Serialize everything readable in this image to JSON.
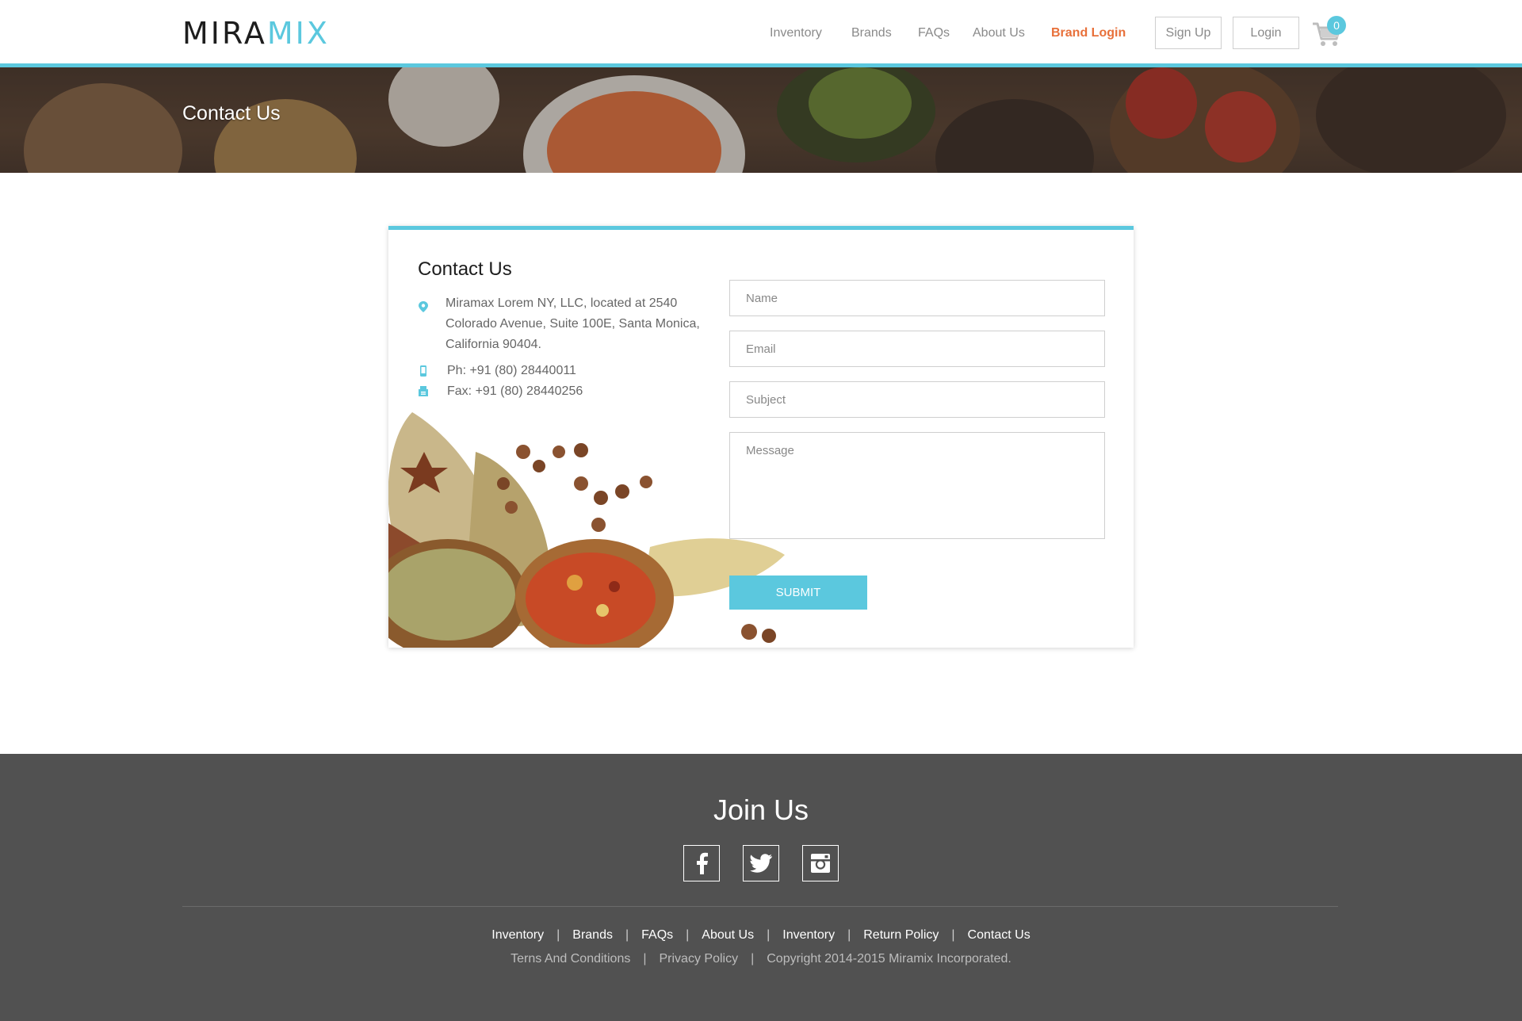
{
  "brand": {
    "logo_part1": "MIRA",
    "logo_part2": "MIX"
  },
  "nav": {
    "items": [
      {
        "label": "Inventory"
      },
      {
        "label": "Brands"
      },
      {
        "label": "FAQs"
      },
      {
        "label": "About Us"
      },
      {
        "label": "Brand Login"
      }
    ],
    "signup_label": "Sign Up",
    "login_label": "Login",
    "cart_count": "0"
  },
  "hero": {
    "title": "Contact Us"
  },
  "contact": {
    "title": "Contact Us",
    "address": "Miramax Lorem NY, LLC, located at 2540 Colorado Avenue, Suite 100E, Santa Monica, California 90404.",
    "phone": "Ph: +91 (80) 28440011",
    "fax": "Fax: +91 (80) 28440256"
  },
  "form": {
    "name_placeholder": "Name",
    "email_placeholder": "Email",
    "subject_placeholder": "Subject",
    "message_placeholder": "Message",
    "submit_label": "SUBMIT"
  },
  "footer": {
    "join_title": "Join Us",
    "links": [
      "Inventory",
      "Brands",
      "FAQs",
      "About Us",
      "Inventory",
      "Return Policy",
      "Contact Us"
    ],
    "legal": [
      "Terns And Conditions",
      "Privacy Policy",
      "Copyright 2014-2015 Miramix Incorporated."
    ]
  },
  "colors": {
    "accent": "#5bc8de",
    "brand_login": "#e8703a",
    "footer_bg": "#515151"
  }
}
